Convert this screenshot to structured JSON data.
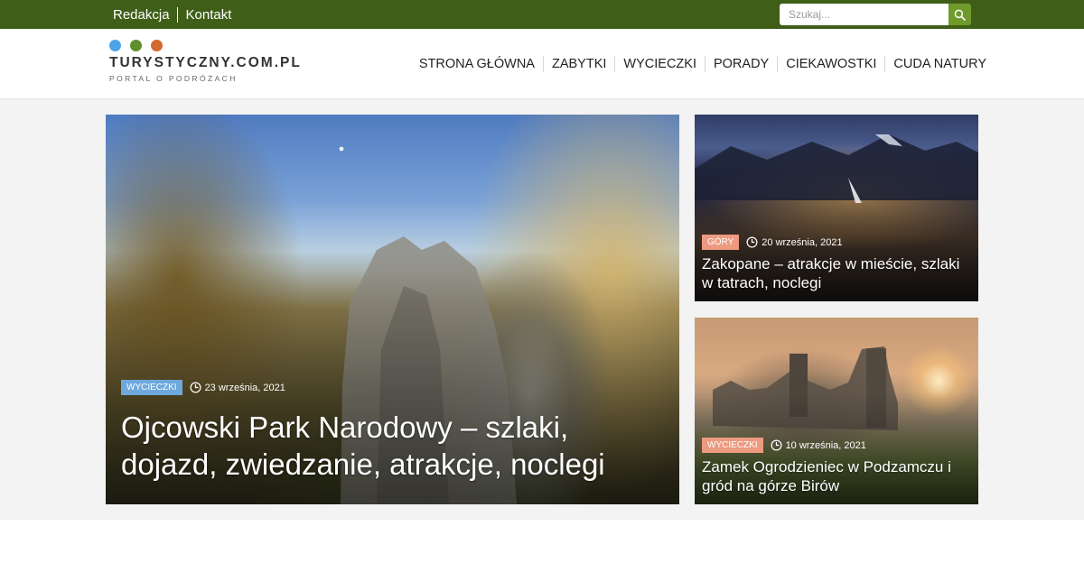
{
  "topbar": {
    "links": [
      "Redakcja",
      "Kontakt"
    ],
    "search_placeholder": "Szukaj...",
    "search_icon": "search-icon",
    "background_color": "#3f5f18",
    "button_color": "#6f9a2c"
  },
  "header": {
    "logo_title": "TURYSTYCZNY.COM.PL",
    "logo_subtitle": "PORTAL O PODRÓŻACH",
    "logo_dot_colors": [
      "#4da3e6",
      "#5f8f2a",
      "#d26a2c"
    ],
    "nav": [
      "STRONA GŁÓWNA",
      "ZABYTKI",
      "WYCIECZKI",
      "PORADY",
      "CIEKAWOSTKI",
      "CUDA NATURY"
    ]
  },
  "featured": {
    "main": {
      "category": "WYCIECZKI",
      "date": "23 września, 2021",
      "title": "Ojcowski Park Narodowy – szlaki, dojazd, zwiedzanie, atrakcje, noclegi",
      "badge_color": "#6ea8dc"
    },
    "side": [
      {
        "category": "GÓRY",
        "date": "20 września, 2021",
        "title": "Zakopane – atrakcje w mieście, szlaki w tatrach, noclegi",
        "badge_color": "#ec9a80"
      },
      {
        "category": "WYCIECZKI",
        "date": "10 września, 2021",
        "title": "Zamek Ogrodzieniec w Podzamczu i gród na górze Birów",
        "badge_color": "#ec9a80"
      }
    ]
  }
}
